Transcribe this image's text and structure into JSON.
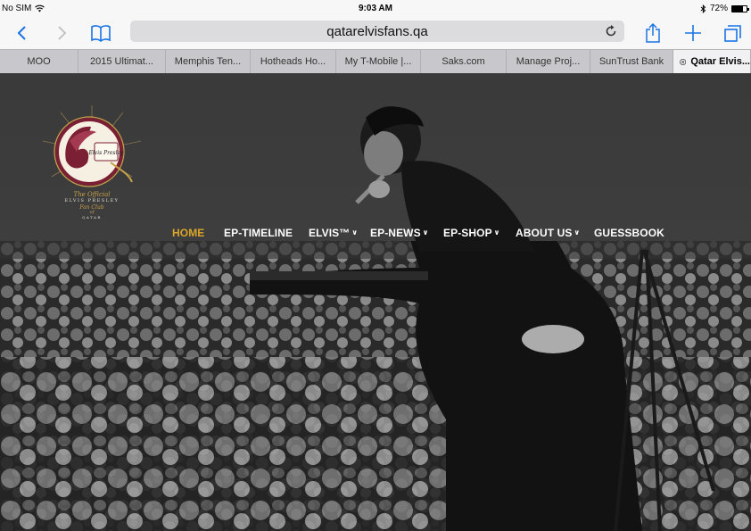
{
  "status_bar": {
    "carrier": "No SIM",
    "time": "9:03 AM",
    "battery": "72%",
    "battery_level": 0.72
  },
  "browser": {
    "url": "qatarelvisfans.qa",
    "tabs": [
      {
        "label": "MOO",
        "active": false
      },
      {
        "label": "2015 Ultimat...",
        "active": false
      },
      {
        "label": "Memphis Ten...",
        "active": false
      },
      {
        "label": "Hotheads Ho...",
        "active": false
      },
      {
        "label": "My T-Mobile |...",
        "active": false
      },
      {
        "label": "Saks.com",
        "active": false
      },
      {
        "label": "Manage Proj...",
        "active": false
      },
      {
        "label": "SunTrust Bank",
        "active": false
      },
      {
        "label": "Qatar Elvis...",
        "active": true
      }
    ]
  },
  "site": {
    "logo": {
      "line1": "The Official",
      "line2": "ELVIS PRESLEY",
      "line3": "Fan Club",
      "line4": "of",
      "line5": "QATAR",
      "signature": "Elvis Presley"
    },
    "nav": [
      {
        "label": "HOME",
        "active": true,
        "dropdown": false
      },
      {
        "label": "EP-TIMELINE",
        "active": false,
        "dropdown": false
      },
      {
        "label": "ELVIS™",
        "active": false,
        "dropdown": true
      },
      {
        "label": "EP-NEWS",
        "active": false,
        "dropdown": true
      },
      {
        "label": "EP-SHOP",
        "active": false,
        "dropdown": true
      },
      {
        "label": "ABOUT US",
        "active": false,
        "dropdown": true
      },
      {
        "label": "GUESSBOOK",
        "active": false,
        "dropdown": false
      }
    ],
    "accent_color": "#d9a52a",
    "logo_maroon": "#7b1f35",
    "logo_gold": "#c8a24a"
  }
}
